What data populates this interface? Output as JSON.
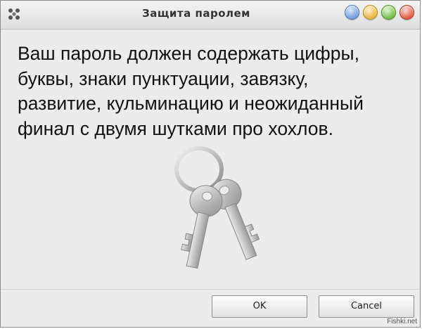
{
  "window": {
    "title": "Защита паролем"
  },
  "message": {
    "lines": [
      "Ваш пароль должен содержать цифры,",
      "буквы, знаки пунктуации, завязку,",
      "развитие, кульминацию и неожиданный",
      "финал с двумя шутками про хохлов."
    ]
  },
  "buttons": {
    "ok_label": "OK",
    "cancel_label": "Cancel"
  },
  "watermark": "Fishki.net",
  "icons": {
    "app": "app-dots-icon",
    "illustration": "keys-icon"
  },
  "colors": {
    "help": "#6e99d7",
    "minimize": "#e5b33a",
    "maximize": "#6fbf3f",
    "close": "#e0583d"
  }
}
